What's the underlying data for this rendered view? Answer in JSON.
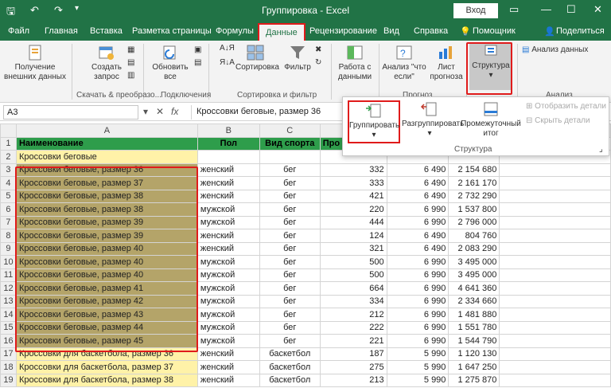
{
  "title": "Группировка  -  Excel",
  "login_label": "Вход",
  "tabs": [
    "Файл",
    "Главная",
    "Вставка",
    "Разметка страницы",
    "Формулы",
    "Данные",
    "Рецензирование",
    "Вид",
    "Справка",
    "Помощник",
    "Поделиться"
  ],
  "ribbon": {
    "get_data": "Получение внешних данных",
    "create_query": "Создать запрос",
    "refresh_all": "Обновить все",
    "sort": "Сортировка",
    "filter": "Фильтр",
    "data_tools": "Работа с данными",
    "whatif": "Анализ \"что если\"",
    "forecast_sheet": "Лист прогноза",
    "structure": "Структура",
    "data_analysis": "Анализ данных",
    "group_labels": {
      "query": "Скачать & преобразо...",
      "connections": "Подключения",
      "sort_filter": "Сортировка и фильтр",
      "forecast": "Прогноз",
      "analysis": "Анализ"
    }
  },
  "popup": {
    "group": "Группировать",
    "ungroup": "Разгруппировать",
    "subtotal": "Промежуточный итог",
    "show_detail": "Отобразить детали",
    "hide_detail": "Скрыть детали",
    "label": "Структура"
  },
  "formula_bar": {
    "name_box": "A3",
    "fx": "fx",
    "value": "Кроссовки беговые, размер 36"
  },
  "columns": [
    "",
    "A",
    "B",
    "C",
    "D",
    "E",
    "F"
  ],
  "rows": [
    {
      "n": "1",
      "a": "Наименование",
      "b": "Пол",
      "c": "Вид спорта",
      "d": "Про",
      "e": "",
      "f": ""
    },
    {
      "n": "2",
      "a": "Кроссовки беговые",
      "b": "",
      "c": "",
      "d": "",
      "e": "",
      "f": ""
    },
    {
      "n": "3",
      "a": "Кроссовки беговые, размер 36",
      "b": "женский",
      "c": "бег",
      "d": "332",
      "e": "6 490",
      "f": "2 154 680"
    },
    {
      "n": "4",
      "a": "Кроссовки беговые, размер 37",
      "b": "женский",
      "c": "бег",
      "d": "333",
      "e": "6 490",
      "f": "2 161 170"
    },
    {
      "n": "5",
      "a": "Кроссовки беговые, размер 38",
      "b": "женский",
      "c": "бег",
      "d": "421",
      "e": "6 490",
      "f": "2 732 290"
    },
    {
      "n": "6",
      "a": "Кроссовки беговые, размер 38",
      "b": "мужской",
      "c": "бег",
      "d": "220",
      "e": "6 990",
      "f": "1 537 800"
    },
    {
      "n": "7",
      "a": "Кроссовки беговые, размер 39",
      "b": "мужской",
      "c": "бег",
      "d": "444",
      "e": "6 990",
      "f": "2 796 000"
    },
    {
      "n": "8",
      "a": "Кроссовки беговые, размер 39",
      "b": "женский",
      "c": "бег",
      "d": "124",
      "e": "6 490",
      "f": "804 760"
    },
    {
      "n": "9",
      "a": "Кроссовки беговые, размер 40",
      "b": "женский",
      "c": "бег",
      "d": "321",
      "e": "6 490",
      "f": "2 083 290"
    },
    {
      "n": "10",
      "a": "Кроссовки беговые, размер 40",
      "b": "мужской",
      "c": "бег",
      "d": "500",
      "e": "6 990",
      "f": "3 495 000"
    },
    {
      "n": "11",
      "a": "Кроссовки беговые, размер 40",
      "b": "мужской",
      "c": "бег",
      "d": "500",
      "e": "6 990",
      "f": "3 495 000"
    },
    {
      "n": "12",
      "a": "Кроссовки беговые, размер 41",
      "b": "мужской",
      "c": "бег",
      "d": "664",
      "e": "6 990",
      "f": "4 641 360"
    },
    {
      "n": "13",
      "a": "Кроссовки беговые, размер 42",
      "b": "мужской",
      "c": "бег",
      "d": "334",
      "e": "6 990",
      "f": "2 334 660"
    },
    {
      "n": "14",
      "a": "Кроссовки беговые, размер 43",
      "b": "мужской",
      "c": "бег",
      "d": "212",
      "e": "6 990",
      "f": "1 481 880"
    },
    {
      "n": "15",
      "a": "Кроссовки беговые, размер 44",
      "b": "мужской",
      "c": "бег",
      "d": "222",
      "e": "6 990",
      "f": "1 551 780"
    },
    {
      "n": "16",
      "a": "Кроссовки беговые, размер 45",
      "b": "мужской",
      "c": "бег",
      "d": "221",
      "e": "6 990",
      "f": "1 544 790"
    },
    {
      "n": "17",
      "a": "Кроссовки для баскетбола, размер 36",
      "b": "женский",
      "c": "баскетбол",
      "d": "187",
      "e": "5 990",
      "f": "1 120 130"
    },
    {
      "n": "18",
      "a": "Кроссовки для баскетбола, размер 37",
      "b": "женский",
      "c": "баскетбол",
      "d": "275",
      "e": "5 990",
      "f": "1 647 250"
    },
    {
      "n": "19",
      "a": "Кроссовки для баскетбола, размер 38",
      "b": "женский",
      "c": "баскетбол",
      "d": "213",
      "e": "5 990",
      "f": "1 275 870"
    }
  ]
}
